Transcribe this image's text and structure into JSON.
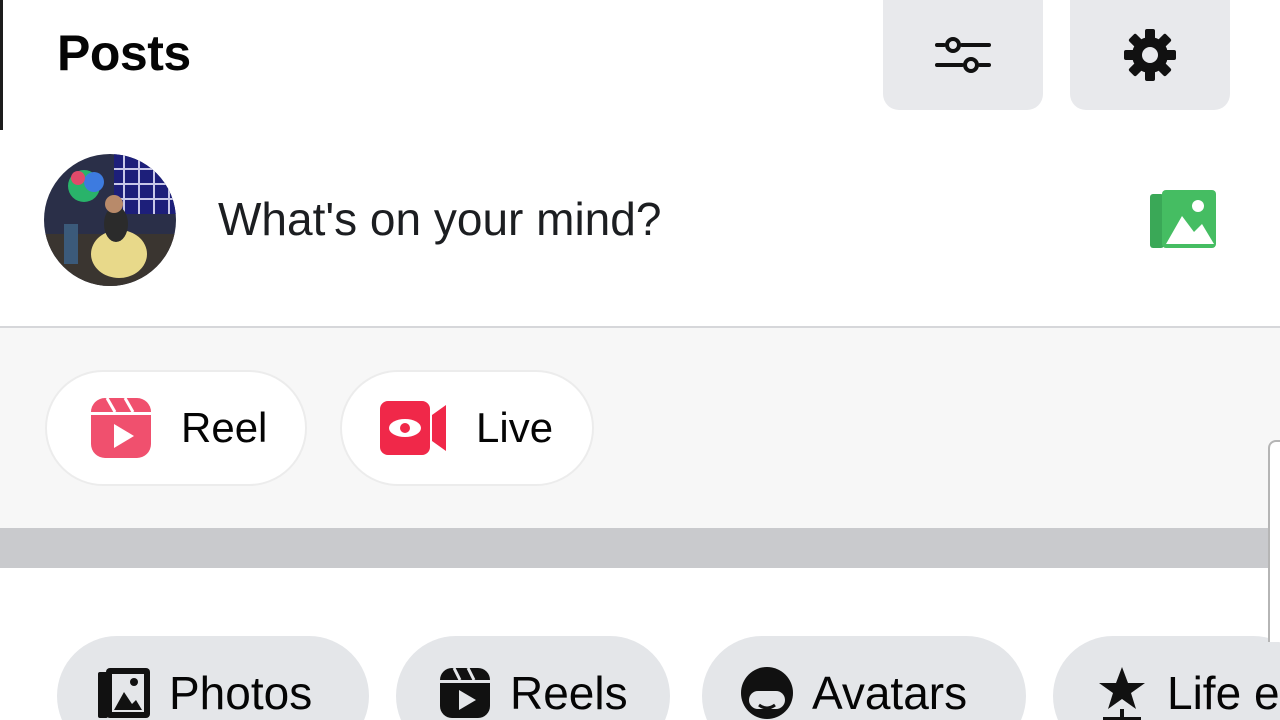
{
  "header": {
    "title": "Posts",
    "filter_icon": "sliders-icon",
    "settings_icon": "gear-icon"
  },
  "composer": {
    "placeholder": "What's on your mind?",
    "avatar_icon": "profile-avatar",
    "photo_icon": "photo-gallery-icon"
  },
  "create": {
    "items": [
      {
        "label": "Reel",
        "icon": "reel-icon"
      },
      {
        "label": "Live",
        "icon": "live-video-icon"
      }
    ]
  },
  "tabs": {
    "items": [
      {
        "label": "Photos",
        "icon": "photos-icon"
      },
      {
        "label": "Reels",
        "icon": "reels-icon"
      },
      {
        "label": "Avatars",
        "icon": "avatar-face-icon"
      },
      {
        "label": "Life e",
        "icon": "star-icon"
      }
    ]
  },
  "colors": {
    "photo_green": "#45bd62",
    "reel_pink": "#f0506e",
    "live_red": "#f02849",
    "chip_bg": "#e4e6e9",
    "icon_btn_bg": "#e8e9ec"
  }
}
